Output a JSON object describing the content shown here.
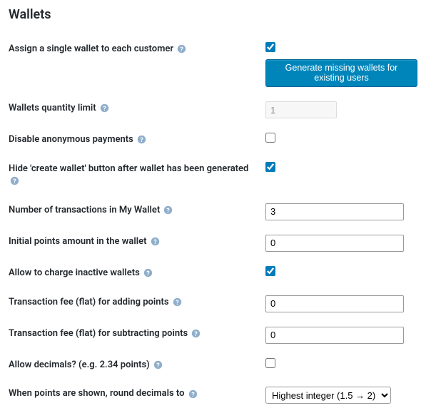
{
  "heading": "Wallets",
  "fields": {
    "assign_single": {
      "label": "Assign a single wallet to each customer",
      "checked": true,
      "button_label": "Generate missing wallets for existing users"
    },
    "quantity_limit": {
      "label": "Wallets quantity limit",
      "value": "1"
    },
    "disable_anon": {
      "label": "Disable anonymous payments",
      "checked": false
    },
    "hide_create": {
      "label": "Hide 'create wallet' button after wallet has been generated",
      "checked": true
    },
    "num_transactions": {
      "label": "Number of transactions in My Wallet",
      "value": "3"
    },
    "initial_points": {
      "label": "Initial points amount in the wallet",
      "value": "0"
    },
    "charge_inactive": {
      "label": "Allow to charge inactive wallets",
      "checked": true
    },
    "fee_add": {
      "label": "Transaction fee (flat) for adding points",
      "value": "0"
    },
    "fee_sub": {
      "label": "Transaction fee (flat) for subtracting points",
      "value": "0"
    },
    "allow_decimals": {
      "label": "Allow decimals? (e.g. 2.34 points)",
      "checked": false
    },
    "round_decimals": {
      "label": "When points are shown, round decimals to",
      "selected": "Highest integer (1.5 → 2)"
    }
  }
}
